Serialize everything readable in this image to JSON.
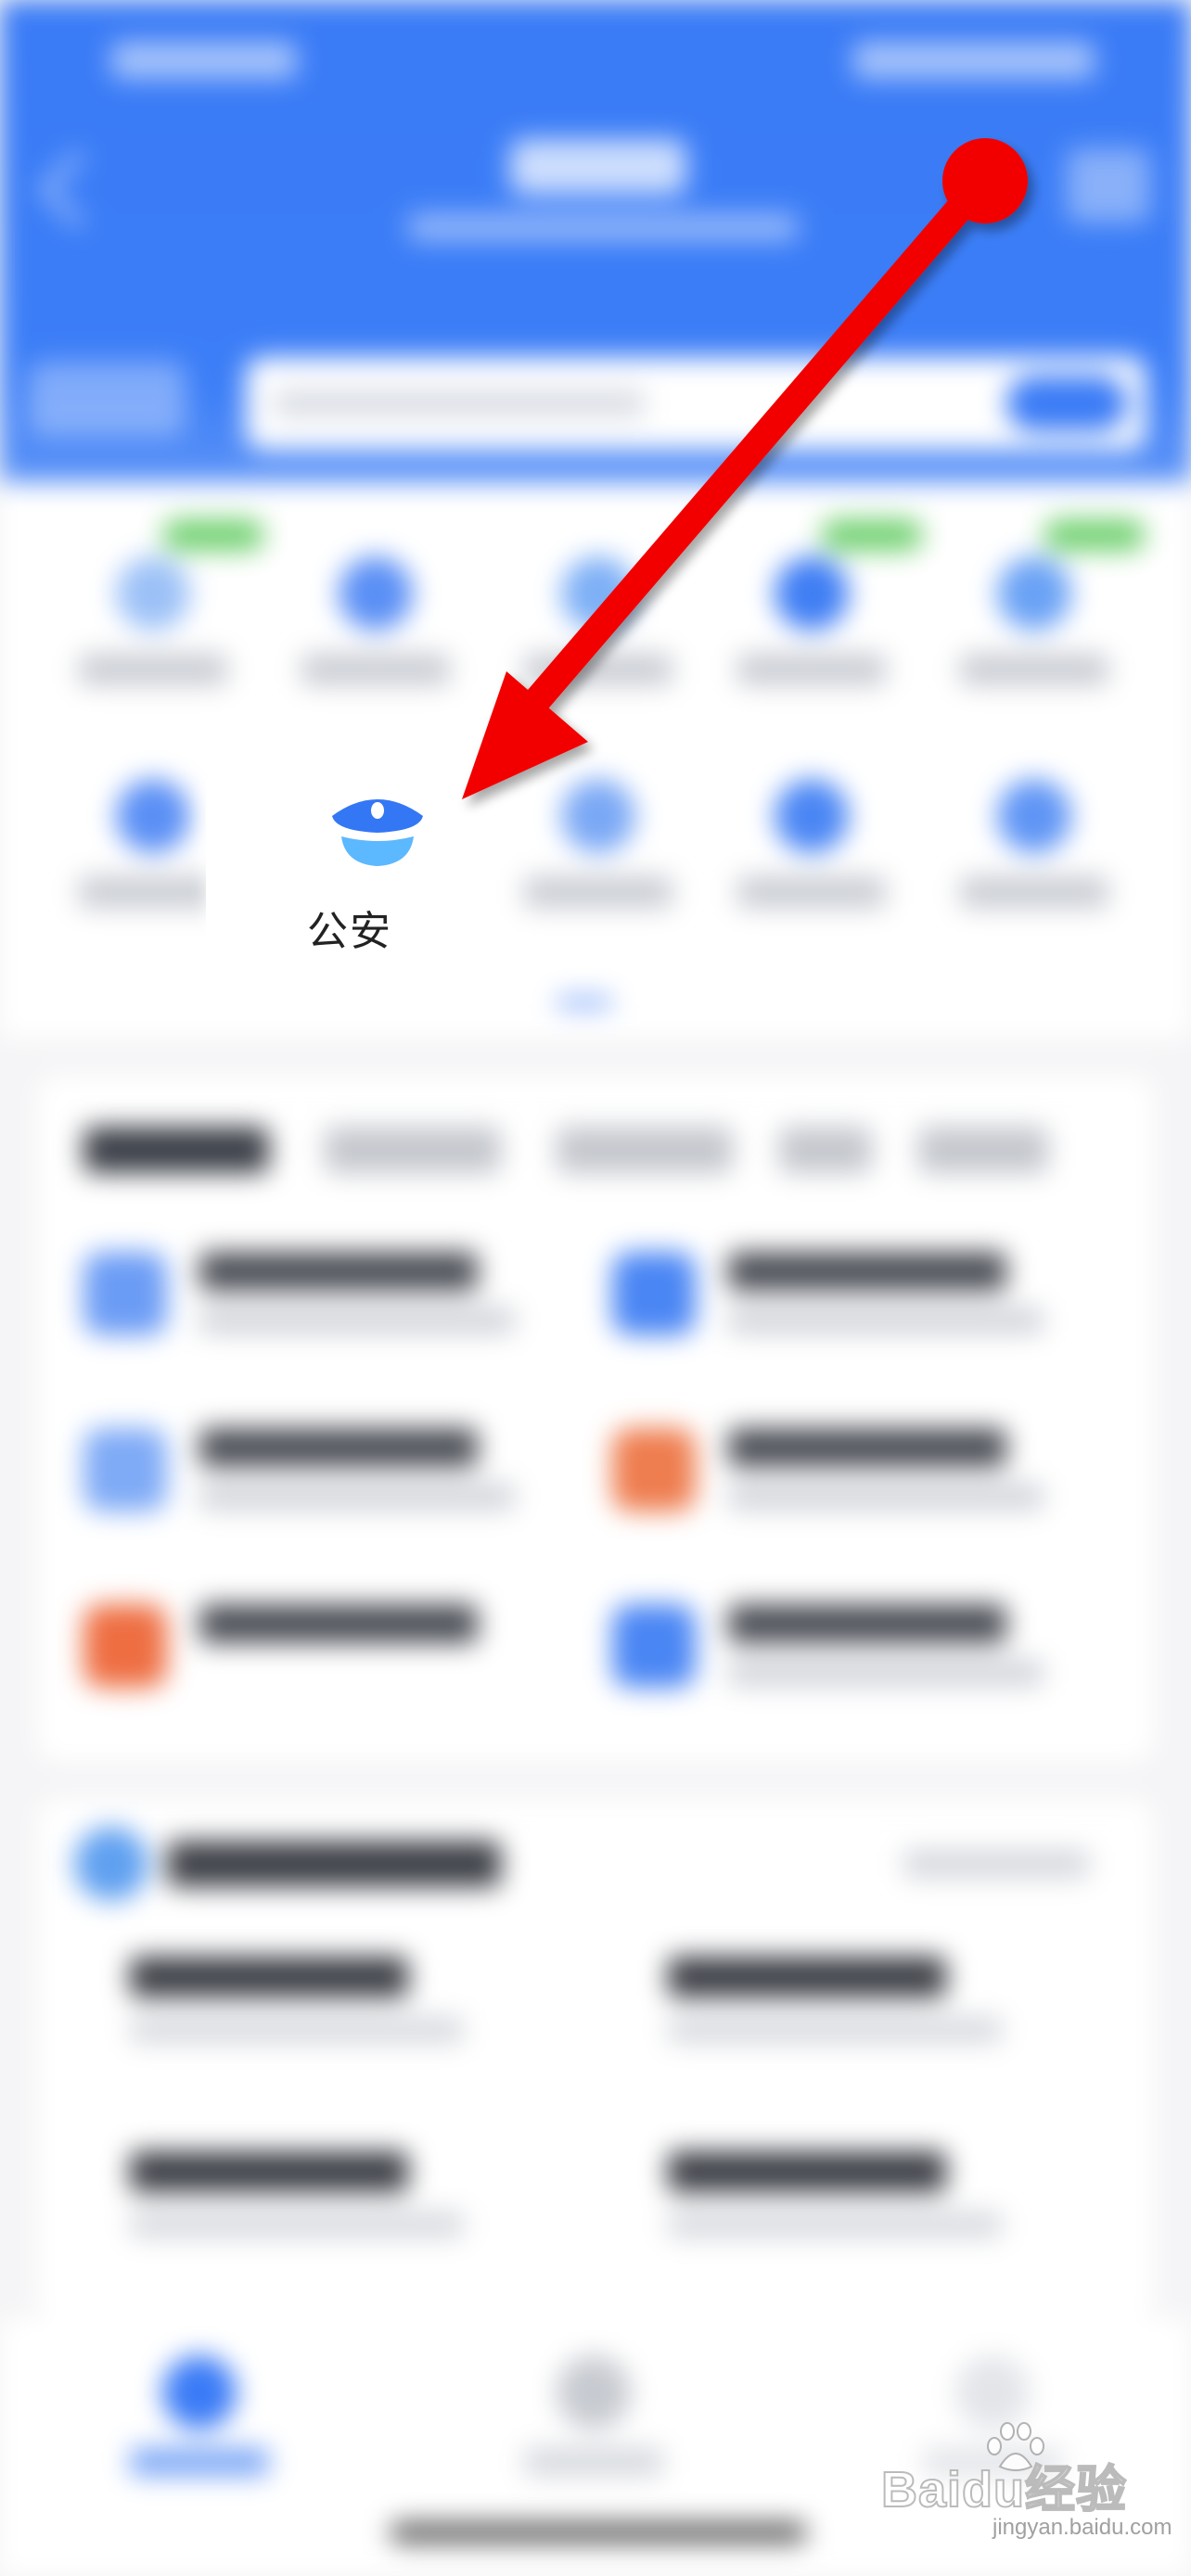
{
  "highlight": {
    "label": "公安",
    "icon": "police-cap-icon"
  },
  "watermark": {
    "brand": "Baidu经验",
    "url": "jingyan.baidu.com"
  },
  "colors": {
    "header_blue": "#3a7bf6",
    "icon_blue": "#3477f5",
    "icon_light_blue": "#5cb8ff",
    "arrow_red": "#f20000"
  }
}
